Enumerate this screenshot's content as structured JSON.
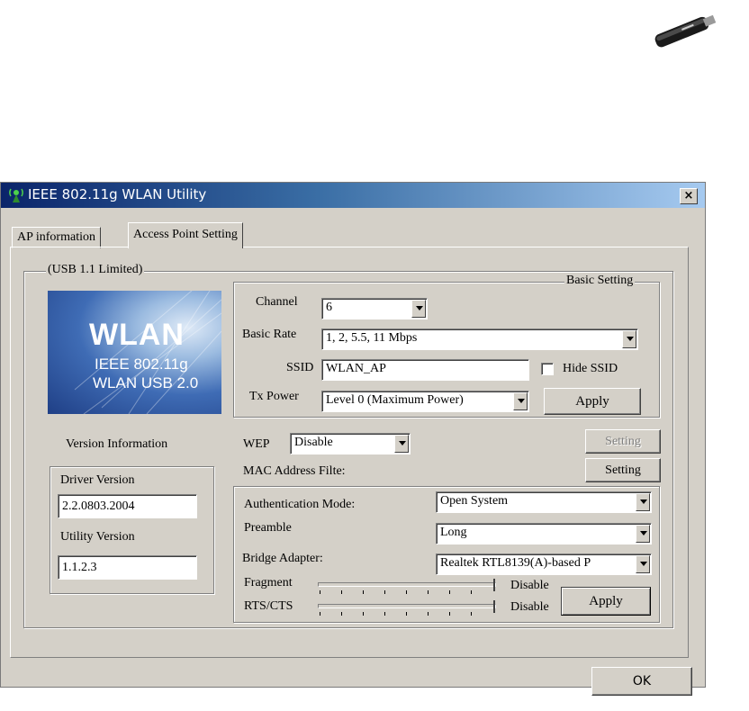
{
  "window": {
    "title": "IEEE 802.11g WLAN Utility",
    "close_label": "×"
  },
  "tabs": [
    {
      "label": "AP information"
    },
    {
      "label": "Access Point Setting"
    }
  ],
  "usb_group": {
    "legend": "(USB 1.1 Limited)"
  },
  "logo": {
    "line1": "WLAN",
    "line2": "IEEE 802.11g",
    "line3": "WLAN USB 2.0"
  },
  "version": {
    "heading": "Version Information",
    "driver_label": "Driver Version",
    "driver_value": "2.2.0803.2004",
    "utility_label": "Utility Version",
    "utility_value": "1.1.2.3"
  },
  "basic_setting": {
    "legend": "Basic Setting",
    "channel_label": "Channel",
    "channel_value": "6",
    "basic_rate_label": "Basic Rate",
    "basic_rate_value": "1, 2, 5.5, 11 Mbps",
    "ssid_label": "SSID",
    "ssid_value": "WLAN_AP",
    "hide_ssid_label": "Hide SSID",
    "tx_power_label": "Tx Power",
    "tx_power_value": "Level 0 (Maximum Power)",
    "apply_label": "Apply"
  },
  "security": {
    "wep_label": "WEP",
    "wep_value": "Disable",
    "wep_setting_label": "Setting",
    "mac_filter_label": "MAC Address Filte:",
    "mac_setting_label": "Setting"
  },
  "advanced": {
    "auth_label": "Authentication Mode:",
    "auth_value": "Open System",
    "preamble_label": "Preamble",
    "preamble_value": "Long",
    "bridge_label": "Bridge Adapter:",
    "bridge_value": "Realtek RTL8139(A)-based P",
    "fragment_label": "Fragment",
    "fragment_state": "Disable",
    "rts_label": "RTS/CTS",
    "rts_state": "Disable",
    "apply_label": "Apply"
  },
  "footer": {
    "ok_label": "OK"
  },
  "colors": {
    "dialog_bg": "#d4d0c8",
    "title_start": "#0a246a",
    "title_end": "#a6caf0"
  },
  "icons": {
    "app": "antenna-icon",
    "device": "usb-dongle-icon"
  }
}
